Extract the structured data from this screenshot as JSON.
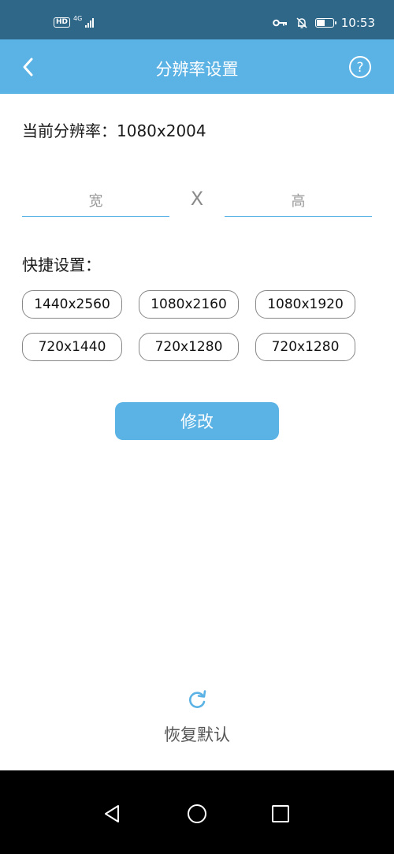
{
  "status_bar": {
    "hd": "HD",
    "network": "4G",
    "time": "10:53",
    "battery_level": 0.55
  },
  "app_bar": {
    "title": "分辨率设置",
    "back_icon": "chevron-left-icon",
    "help_icon": "question-circle-icon"
  },
  "current": {
    "text": "当前分辨率：1080x2004"
  },
  "inputs": {
    "width_placeholder": "宽",
    "width_value": "",
    "separator": "X",
    "height_placeholder": "高",
    "height_value": ""
  },
  "quick": {
    "label": "快捷设置：",
    "presets": [
      "1440x2560",
      "1080x2160",
      "1080x1920",
      "720x1440",
      "720x1280",
      "720x1280"
    ]
  },
  "modify_button": {
    "label": "修改"
  },
  "reset": {
    "label": "恢复默认",
    "icon": "refresh-icon"
  },
  "colors": {
    "status_bar": "#2f6789",
    "accent": "#5bb2e4",
    "nav_bar": "#000000"
  },
  "nav": {
    "icons": [
      "back-triangle-icon",
      "home-circle-icon",
      "recents-square-icon"
    ]
  }
}
